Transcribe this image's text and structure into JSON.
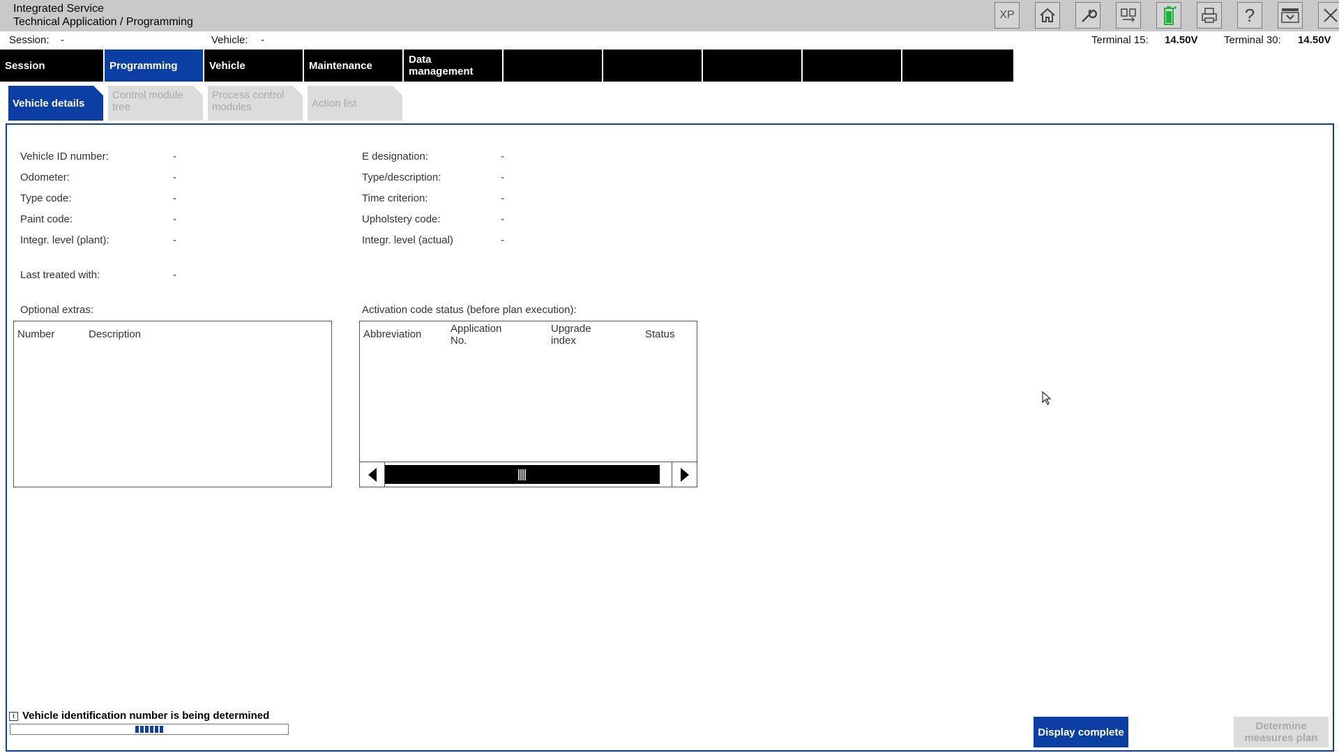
{
  "app": {
    "title_line1": "Integrated Service",
    "title_line2": "Technical Application / Programming"
  },
  "toolbar": {
    "xp_label": "XP",
    "icons": [
      "xp-icon",
      "home-icon",
      "wrench-icon",
      "connection-icon",
      "battery-icon",
      "print-icon",
      "help-icon",
      "dropdown-menu-icon",
      "close-icon"
    ],
    "battery_color": "#1db33a"
  },
  "infobar": {
    "session_label": "Session:",
    "session_value": "-",
    "vehicle_label": "Vehicle:",
    "vehicle_value": "-",
    "terminal15_label": "Terminal 15:",
    "terminal15_value": "14.50V",
    "terminal30_label": "Terminal 30:",
    "terminal30_value": "14.50V"
  },
  "nav": {
    "tabs": [
      {
        "label": "Session"
      },
      {
        "label": "Programming"
      },
      {
        "label": "Vehicle"
      },
      {
        "label": "Maintenance"
      },
      {
        "label": "Data\nmanagement"
      },
      {
        "label": ""
      },
      {
        "label": ""
      },
      {
        "label": ""
      },
      {
        "label": ""
      },
      {
        "label": ""
      }
    ],
    "active_index": 1
  },
  "subtabs": [
    {
      "label": "Vehicle details"
    },
    {
      "label": "Control module\ntree"
    },
    {
      "label": "Process control\nmodules"
    },
    {
      "label": "Action list"
    }
  ],
  "details": {
    "left": [
      {
        "label": "Vehicle ID number:",
        "value": "-"
      },
      {
        "label": "Odometer:",
        "value": "-"
      },
      {
        "label": "Type code:",
        "value": "-"
      },
      {
        "label": "Paint code:",
        "value": "-"
      },
      {
        "label": "Integr. level (plant):",
        "value": "-"
      }
    ],
    "right": [
      {
        "label": "E designation:",
        "value": "-"
      },
      {
        "label": "Type/description:",
        "value": "-"
      },
      {
        "label": "Time criterion:",
        "value": "-"
      },
      {
        "label": "Upholstery code:",
        "value": "-"
      },
      {
        "label": "Integr. level (actual)",
        "value": "-"
      }
    ],
    "last_treated_label": "Last treated with:",
    "last_treated_value": "-"
  },
  "optional_extras": {
    "title": "Optional extras:",
    "columns": [
      "Number",
      "Description"
    ]
  },
  "activation": {
    "title": "Activation code status (before plan execution):",
    "columns": [
      "Abbreviation",
      "Application\nNo.",
      "Upgrade\nindex",
      "Status"
    ]
  },
  "status": {
    "message": "Vehicle identification number is being determined",
    "progress_fraction": 0.5
  },
  "buttons": {
    "display_complete": "Display complete",
    "determine_measures": "Determine\nmeasures plan"
  }
}
